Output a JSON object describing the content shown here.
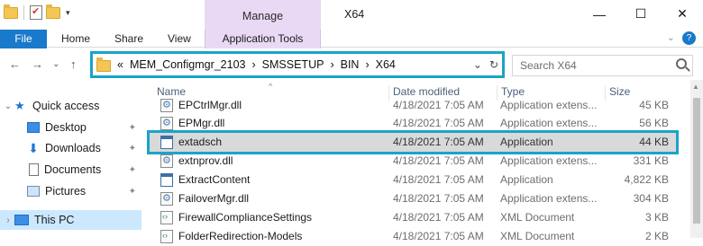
{
  "window": {
    "title": "X64",
    "minimize": "—",
    "maximize": "☐",
    "close": "✕"
  },
  "ribbon": {
    "context_group": "Manage",
    "tabs": [
      "File",
      "Home",
      "Share",
      "View"
    ],
    "context_tab": "Application Tools",
    "expand_glyph": "⌄",
    "help_glyph": "?"
  },
  "nav": {
    "back": "←",
    "forward": "→",
    "history": "⌄",
    "up": "↑",
    "breadcrumb_overflow": "«",
    "path": [
      "MEM_Configmgr_2103",
      "SMSSETUP",
      "BIN",
      "X64"
    ],
    "separator": "›",
    "dropdown": "⌄",
    "refresh": "↻"
  },
  "search": {
    "placeholder": "Search X64"
  },
  "sidebar": {
    "quick_access": "Quick access",
    "items": [
      {
        "label": "Desktop",
        "pinned": true
      },
      {
        "label": "Downloads",
        "pinned": true
      },
      {
        "label": "Documents",
        "pinned": true
      },
      {
        "label": "Pictures",
        "pinned": true
      }
    ],
    "this_pc": "This PC",
    "pin_glyph": "✦"
  },
  "columns": {
    "name": "Name",
    "date": "Date modified",
    "type": "Type",
    "size": "Size",
    "sort_indicator": "^"
  },
  "files": [
    {
      "name": "EPCtrlMgr.dll",
      "date": "4/18/2021 7:05 AM",
      "type": "Application extens...",
      "size": "45 KB",
      "icon": "dll"
    },
    {
      "name": "EPMgr.dll",
      "date": "4/18/2021 7:05 AM",
      "type": "Application extens...",
      "size": "56 KB",
      "icon": "dll"
    },
    {
      "name": "extadsch",
      "date": "4/18/2021 7:05 AM",
      "type": "Application",
      "size": "44 KB",
      "icon": "app",
      "selected": true
    },
    {
      "name": "extnprov.dll",
      "date": "4/18/2021 7:05 AM",
      "type": "Application extens...",
      "size": "331 KB",
      "icon": "dll"
    },
    {
      "name": "ExtractContent",
      "date": "4/18/2021 7:05 AM",
      "type": "Application",
      "size": "4,822 KB",
      "icon": "app"
    },
    {
      "name": "FailoverMgr.dll",
      "date": "4/18/2021 7:05 AM",
      "type": "Application extens...",
      "size": "304 KB",
      "icon": "dll"
    },
    {
      "name": "FirewallComplianceSettings",
      "date": "4/18/2021 7:05 AM",
      "type": "XML Document",
      "size": "3 KB",
      "icon": "xml"
    },
    {
      "name": "FolderRedirection-Models",
      "date": "4/18/2021 7:05 AM",
      "type": "XML Document",
      "size": "2 KB",
      "icon": "xml"
    }
  ],
  "colors": {
    "accent": "#1979ca",
    "highlight_box": "#1ba3c9",
    "context_tab": "#ead9f4"
  }
}
